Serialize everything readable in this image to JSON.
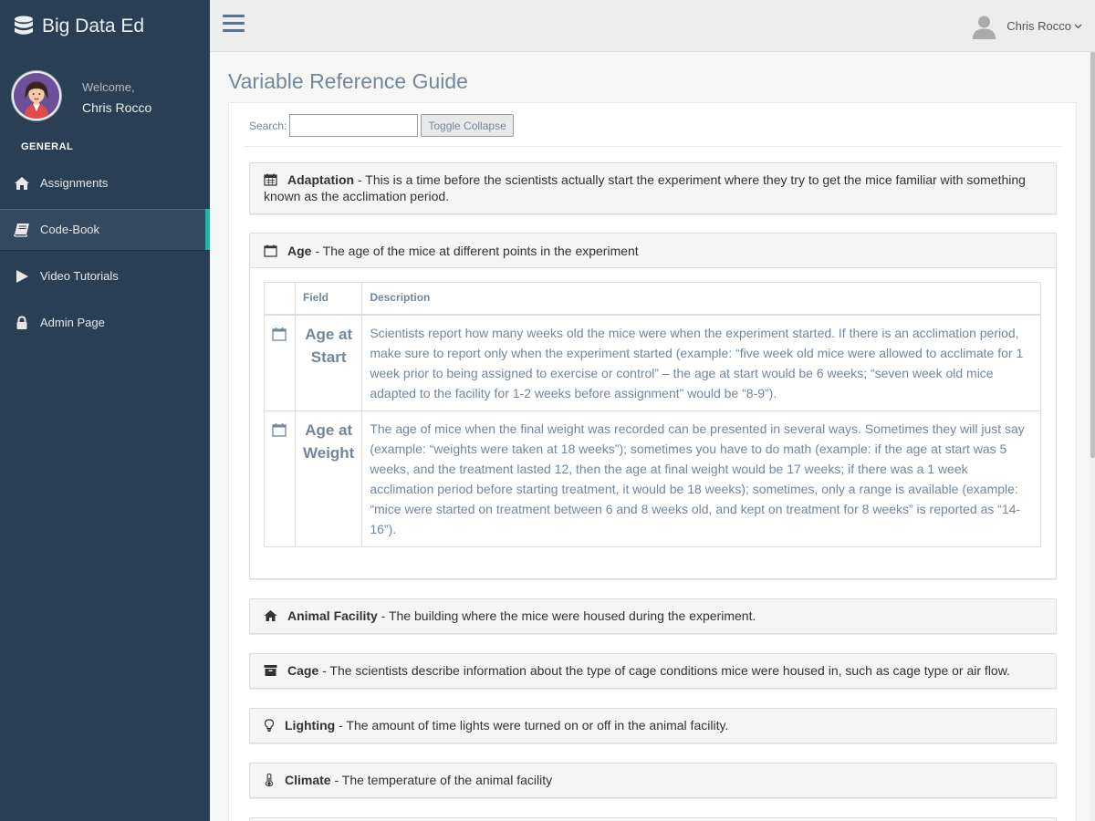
{
  "brand": {
    "name": "Big Data Ed",
    "icon": "database-icon"
  },
  "profile": {
    "welcome": "Welcome,",
    "name": "Chris Rocco"
  },
  "sidebar": {
    "section_title": "GENERAL",
    "items": [
      {
        "label": "Assignments",
        "icon": "home-icon"
      },
      {
        "label": "Code-Book",
        "icon": "book-icon",
        "active": true
      },
      {
        "label": "Video Tutorials",
        "icon": "play-icon"
      },
      {
        "label": "Admin Page",
        "icon": "lock-icon"
      }
    ]
  },
  "topnav": {
    "user_name": "Chris Rocco"
  },
  "page": {
    "title": "Variable Reference Guide"
  },
  "search": {
    "label": "Search:",
    "value": "",
    "toggle_label": "Toggle Collapse"
  },
  "accordion": [
    {
      "name": "Adaptation",
      "desc": " - This is a time before the scientists actually start the experiment where they try to get the mice familiar with something known as the acclimation period.",
      "icon": "calendar-icon"
    },
    {
      "name": "Age",
      "desc": " - The age of the mice at different points in the experiment",
      "icon": "calendar-icon",
      "expanded": true,
      "table": {
        "headers": [
          "",
          "Field",
          "Description"
        ],
        "rows": [
          {
            "field": "Age at Start",
            "desc": "Scientists report how many weeks old the mice were when the experiment started. If there is an acclimation period, make sure to report only when the experiment started (example: “five week old mice were allowed to acclimate for 1 week prior to being assigned to exercise or control” – the age at start would be 6 weeks; “seven week old mice adapted to the facility for 1-2 weeks before assignment” would be “8-9”)."
          },
          {
            "field": "Age at Weight",
            "desc": "The age of mice when the final weight was recorded can be presented in several ways. Sometimes they will just say (example: “weights were taken at 18 weeks”); sometimes you have to do math (example: if the age at start was 5 weeks, and the treatment lasted 12, then the age at final weight would be 17 weeks; if there was a 1 week acclimation period before starting treatment, it would be 18 weeks); sometimes, only a range is available (example: “mice were started on treatment between 6 and 8 weeks old, and kept on treatment for 8 weeks” is reported as “14-16”)."
          }
        ]
      }
    },
    {
      "name": "Animal Facility",
      "desc": " - The building where the mice were housed during the experiment.",
      "icon": "home-icon"
    },
    {
      "name": "Cage",
      "desc": " - The scientists describe information about the type of cage conditions mice were housed in, such as cage type or air flow.",
      "icon": "archive-icon"
    },
    {
      "name": "Lighting",
      "desc": " - The amount of time lights were turned on or off in the animal facility.",
      "icon": "lightbulb-icon"
    },
    {
      "name": "Climate",
      "desc": " - The temperature of the animal facility",
      "icon": "thermometer-icon"
    }
  ]
}
